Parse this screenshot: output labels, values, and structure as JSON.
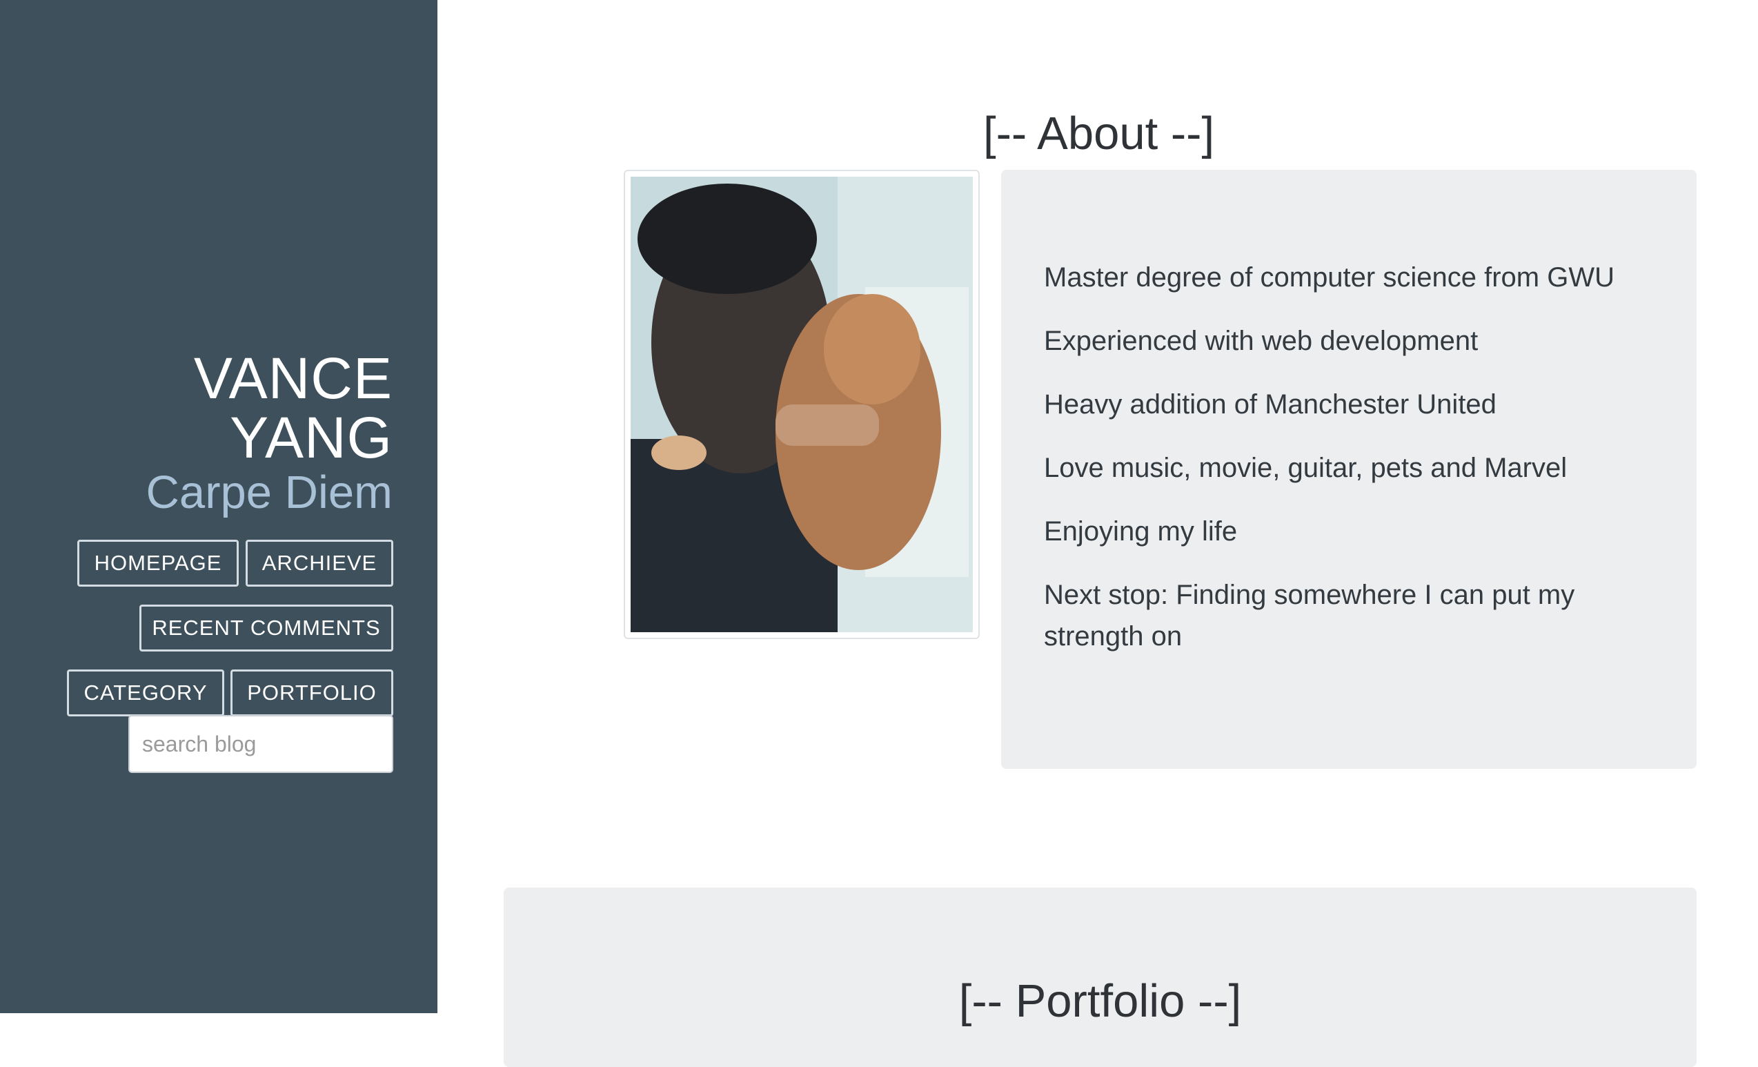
{
  "sidebar": {
    "name_line1": "VANCE",
    "name_line2": "YANG",
    "tagline": "Carpe Diem",
    "nav": {
      "homepage": "HOMEPAGE",
      "archieve": "ARCHIEVE",
      "recent_comments": "RECENT COMMENTS",
      "category": "CATEGORY",
      "portfolio": "PORTFOLIO"
    },
    "search": {
      "placeholder": "search blog",
      "value": ""
    }
  },
  "about": {
    "title": "[-- About --]",
    "lines": [
      "Master degree of computer science from GWU",
      "Experienced with web development",
      "Heavy addition of Manchester United",
      "Love music, movie, guitar, pets and Marvel",
      "Enjoying my life",
      "Next stop: Finding somewhere I can put my strength on"
    ]
  },
  "portfolio": {
    "title": "[-- Portfolio --]"
  },
  "colors": {
    "sidebar_bg": "#3e505b",
    "tagline": "#a9c1d6",
    "card_bg": "#edeef0"
  }
}
